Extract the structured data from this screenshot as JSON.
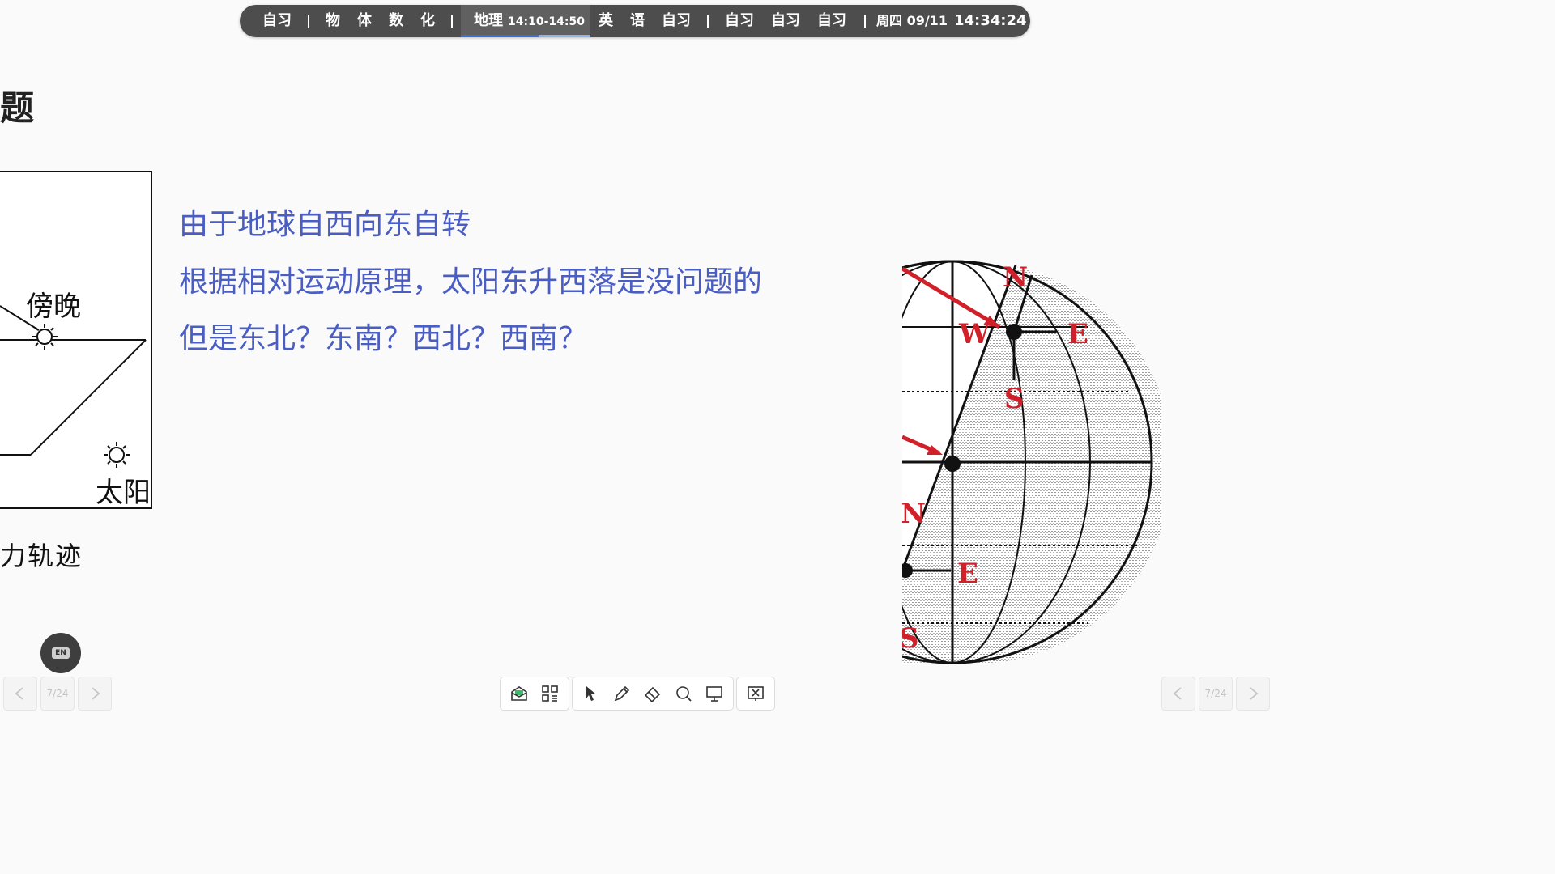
{
  "schedule": {
    "items": [
      {
        "label": "自习"
      },
      {
        "label": "物"
      },
      {
        "label": "体"
      },
      {
        "label": "数"
      },
      {
        "label": "化"
      },
      {
        "label": "英"
      },
      {
        "label": "语"
      },
      {
        "label": "自习"
      },
      {
        "label": "自习"
      },
      {
        "label": "自习"
      },
      {
        "label": "自习"
      }
    ],
    "current": {
      "label": "地理",
      "time": "14:10-14:50",
      "progress_percent": 60
    },
    "date": "周四 09/11",
    "clock": "14:34:24"
  },
  "slide": {
    "title_fragment": "题",
    "lines": [
      "由于地球自西向东自转",
      "根据相对运动原理，太阳东升西落是没问题的",
      "但是东北？东南？西北？西南？"
    ],
    "bottom_fragment": "力轨迹",
    "left_diagram": {
      "label_evening": "傍晚",
      "label_sun": "太阳"
    },
    "globe_labels": {
      "n_top": "N",
      "w": "W",
      "e_top": "E",
      "s_top": "S",
      "n_bottom": "N",
      "e_bottom": "E",
      "s_bottom": "S"
    }
  },
  "lang_button": {
    "label": "EN"
  },
  "pager": {
    "left": "7/24",
    "right": "7/24"
  },
  "colors": {
    "accent_text": "#4a5dc2",
    "bar_bg": "#4d4d4d",
    "globe_red": "#d0202a"
  }
}
